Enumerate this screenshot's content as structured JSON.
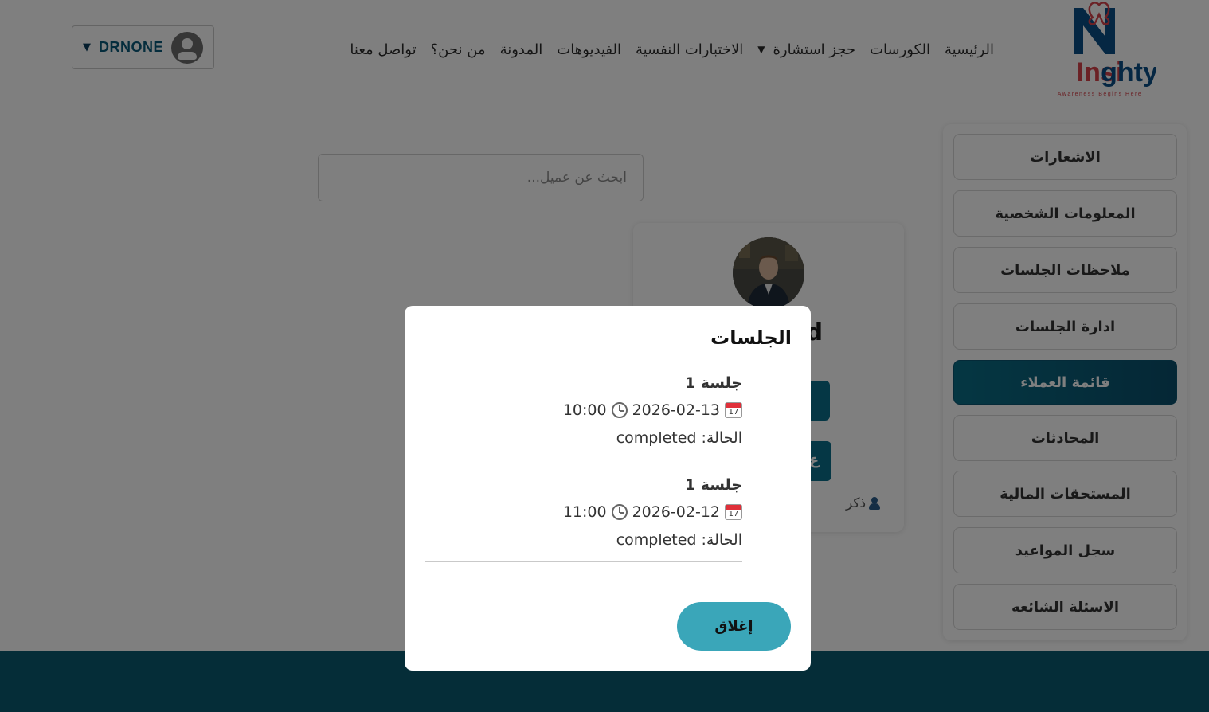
{
  "header": {
    "logo": {
      "name": "Insighty",
      "tagline": "Awareness Begins Here"
    },
    "nav": [
      {
        "label": "الرئيسية"
      },
      {
        "label": "الكورسات"
      },
      {
        "label": "حجز استشارة"
      },
      {
        "label": "الاختبارات النفسية"
      },
      {
        "label": "الفيديوهات"
      },
      {
        "label": "المدونة"
      },
      {
        "label": "من نحن؟"
      },
      {
        "label": "تواصل معنا"
      }
    ],
    "nav_dropdown_caret": "▼",
    "user": {
      "name": "DRNONE",
      "caret": "▼"
    }
  },
  "search": {
    "placeholder": "ابحث عن عميل..."
  },
  "sidebar": {
    "items": [
      {
        "label": "الاشعارات"
      },
      {
        "label": "المعلومات الشخصية"
      },
      {
        "label": "ملاحظات الجلسات"
      },
      {
        "label": "ادارة الجلسات"
      },
      {
        "label": "قائمة العملاء",
        "active": true
      },
      {
        "label": "المحادثات"
      },
      {
        "label": "المستحقات المالية"
      },
      {
        "label": "سجل المواعيد"
      },
      {
        "label": "الاسئلة الشائعه"
      }
    ]
  },
  "client_card": {
    "name_partial": "med",
    "btn1_partial": "-",
    "btn2_partial": "ع",
    "gender": "ذكر"
  },
  "modal": {
    "title": "الجلسات",
    "sessions": [
      {
        "title": "جلسة 1",
        "date": "2026-02-13",
        "time": "10:00",
        "status_label": "الحالة:",
        "status": "completed"
      },
      {
        "title": "جلسة 1",
        "date": "2026-02-12",
        "time": "11:00",
        "status_label": "الحالة:",
        "status": "completed"
      }
    ],
    "close_label": "إغلاق"
  },
  "colors": {
    "primary": "#0b5a70",
    "active_sidebar": "#0b5470",
    "close_button": "#3aa6b9",
    "logo_blue": "#0b4f86",
    "logo_red": "#d6434b"
  }
}
